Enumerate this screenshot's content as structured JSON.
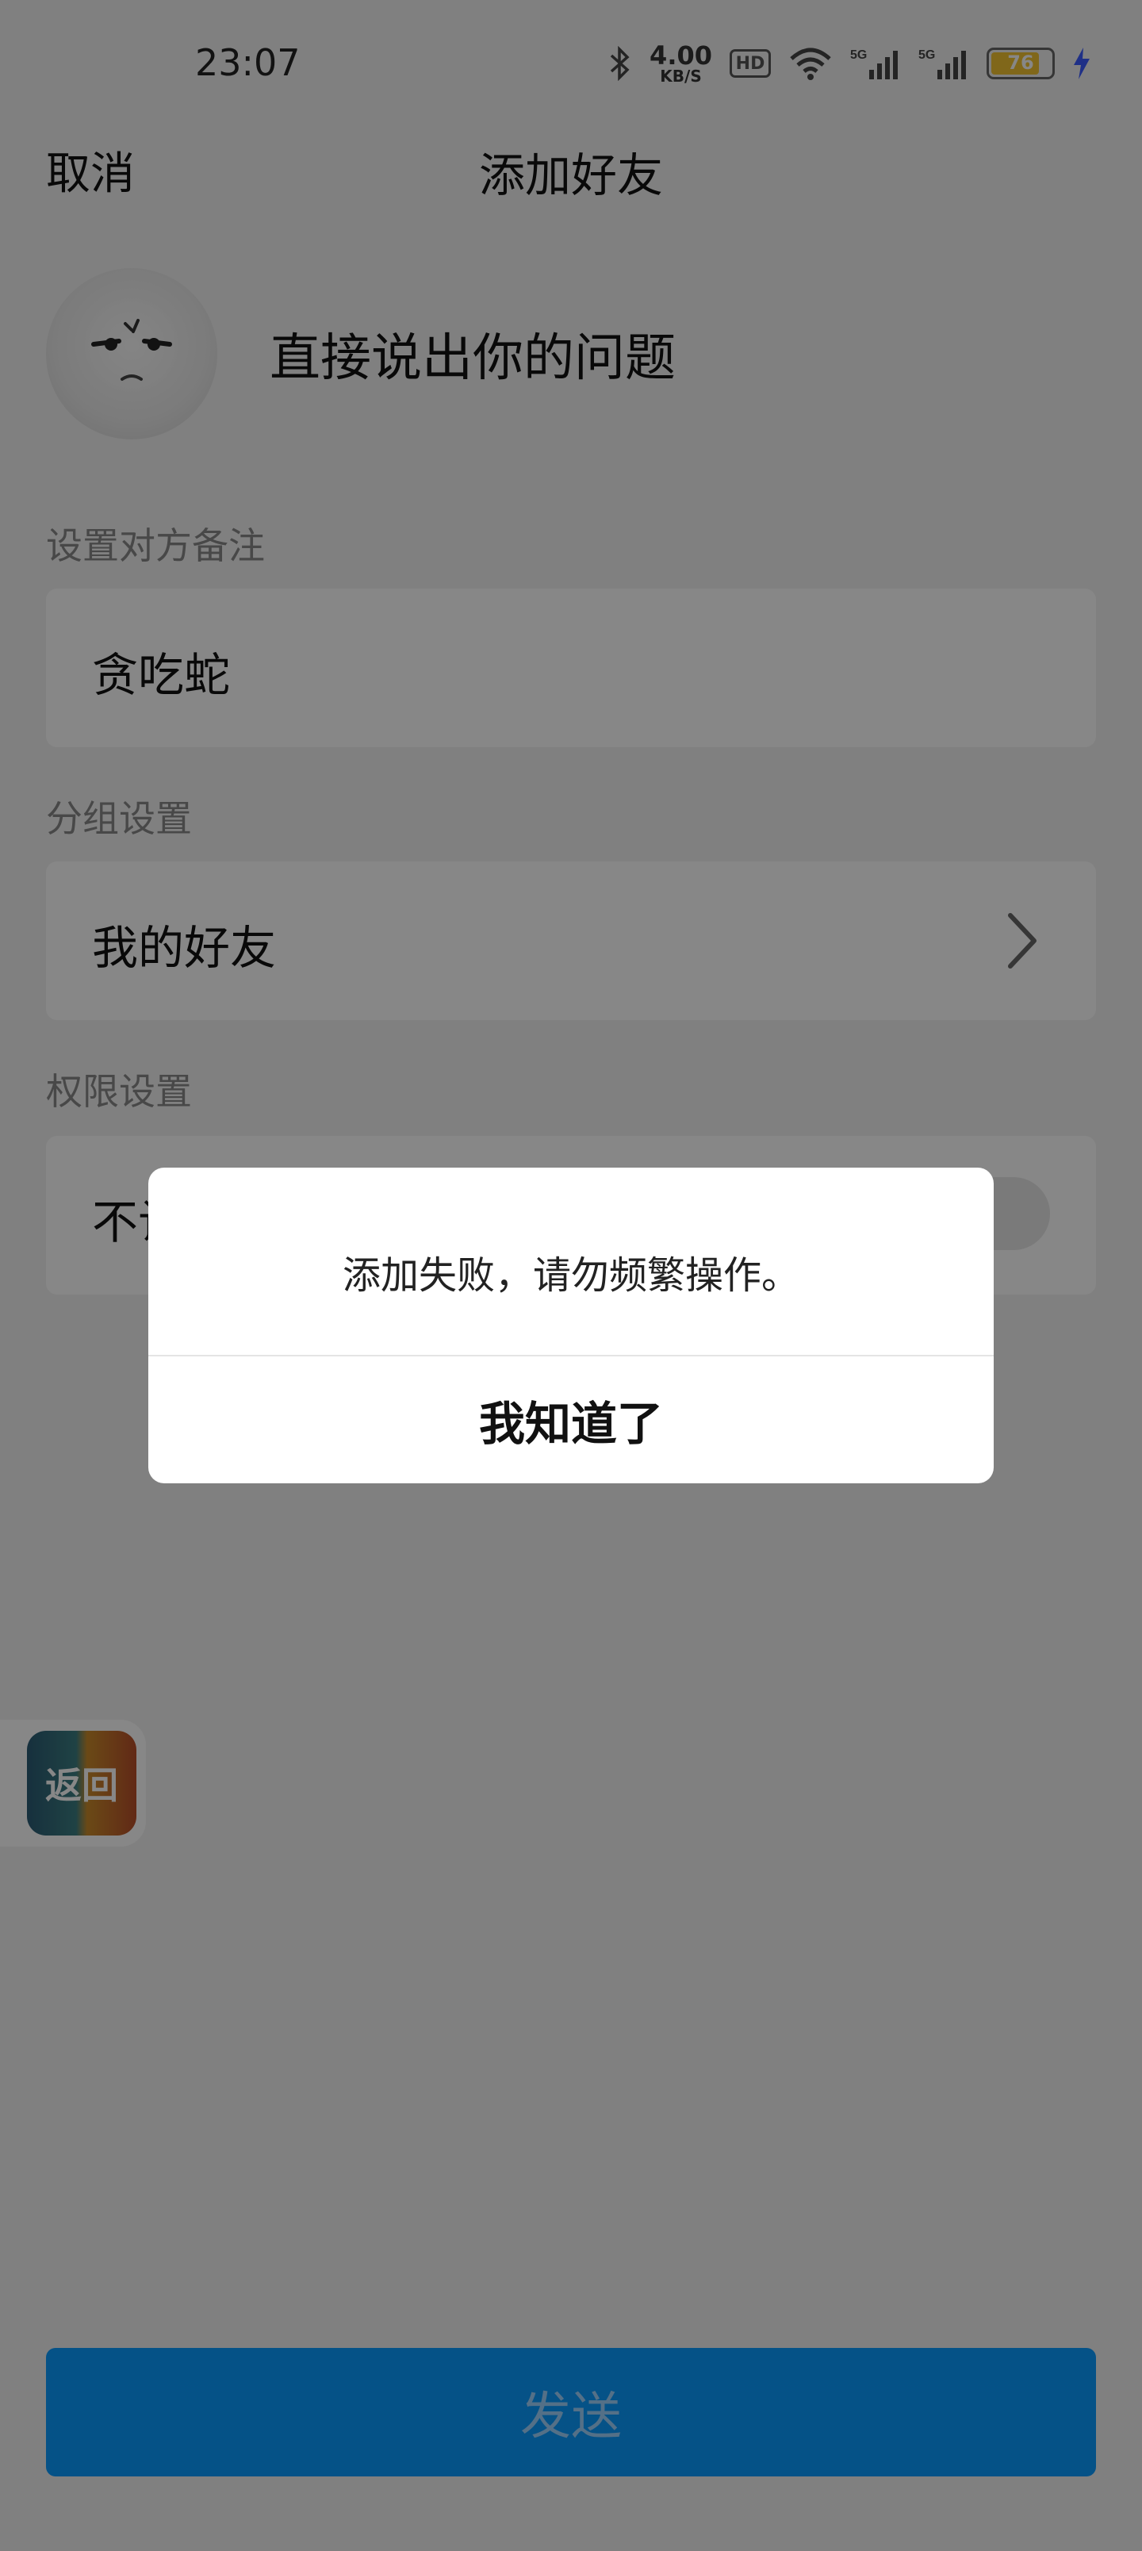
{
  "status_bar": {
    "time": "23:07",
    "net_speed_value": "4.00",
    "net_speed_unit": "KB/S",
    "hd_label": "HD",
    "signal_1": "5G",
    "signal_2": "5G",
    "battery_level": "76"
  },
  "nav": {
    "cancel_label": "取消",
    "title": "添加好友"
  },
  "profile": {
    "name": "直接说出你的问题"
  },
  "remark": {
    "label": "设置对方备注",
    "value": "贪吃蛇"
  },
  "group": {
    "label": "分组设置",
    "value": "我的好友"
  },
  "permission": {
    "label": "权限设置",
    "value": "不让"
  },
  "float_back": {
    "label": "返回"
  },
  "send_button": {
    "label": "发送"
  },
  "dialog": {
    "message": "添加失败，请勿频繁操作。",
    "confirm_label": "我知道了"
  }
}
